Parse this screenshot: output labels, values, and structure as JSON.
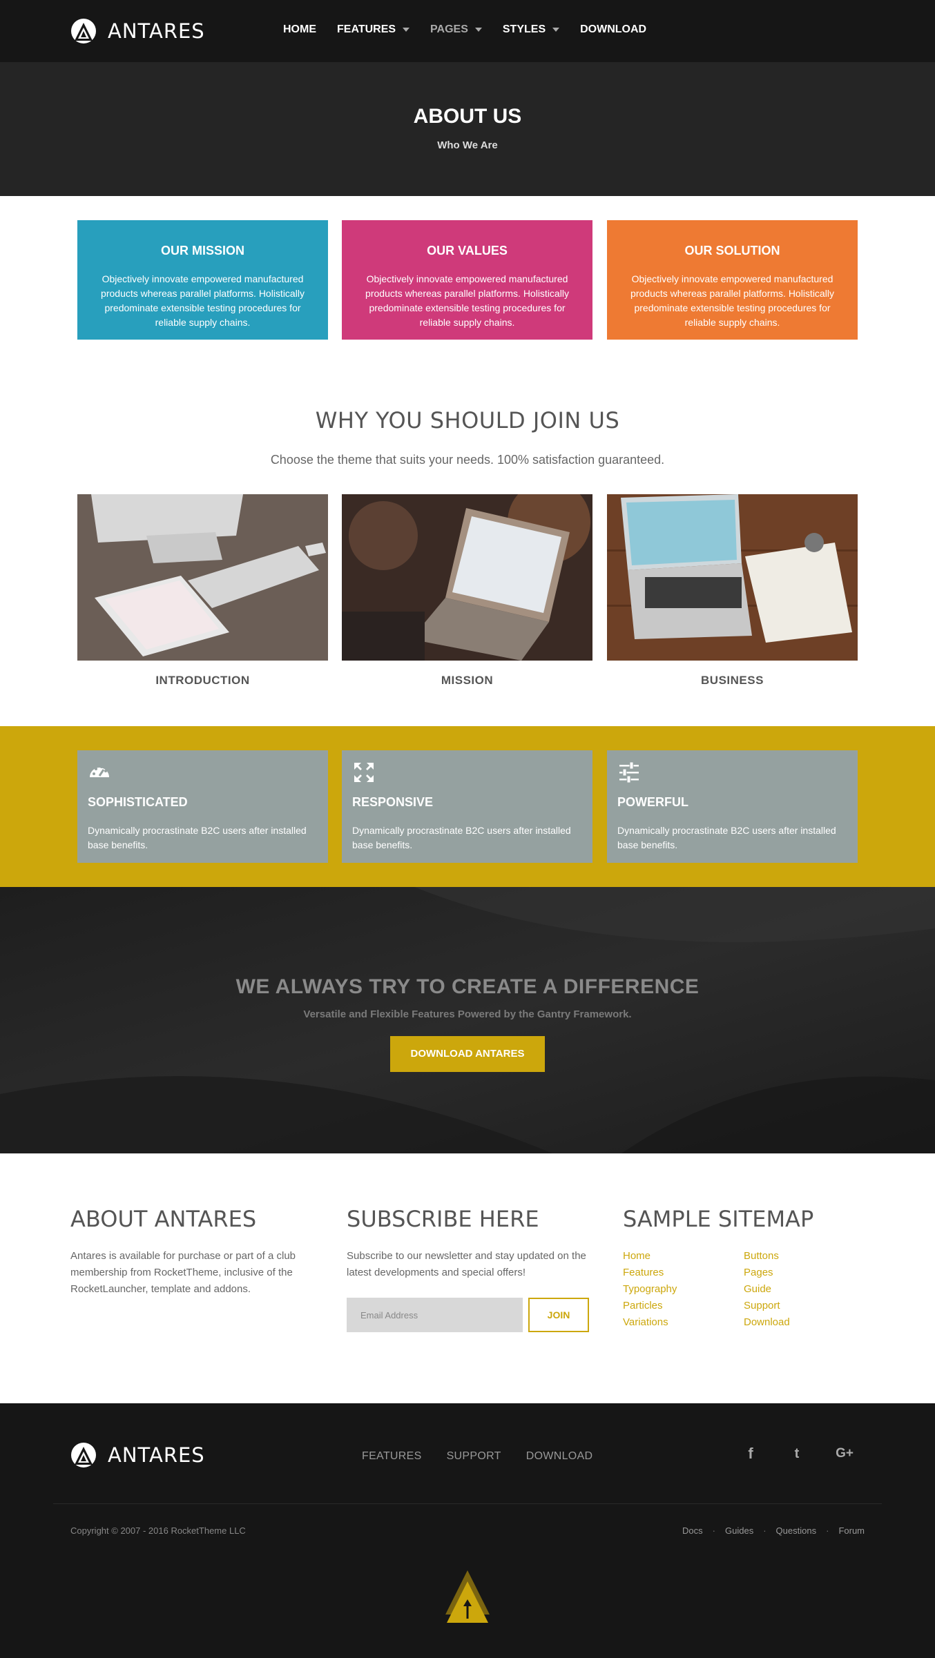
{
  "header": {
    "logo_text": "ANTARES",
    "nav": [
      {
        "label": "HOME"
      },
      {
        "label": "FEATURES"
      },
      {
        "label": "PAGES"
      },
      {
        "label": "STYLES"
      },
      {
        "label": "DOWNLOAD"
      }
    ]
  },
  "hero": {
    "title": "ABOUT US",
    "subtitle": "Who We Are"
  },
  "cards": [
    {
      "title": "OUR MISSION",
      "text": "Objectively innovate empowered manufactured products whereas parallel platforms. Holistically predominate extensible testing procedures for reliable supply chains.",
      "color": "#289fbd"
    },
    {
      "title": "OUR VALUES",
      "text": "Objectively innovate empowered manufactured products whereas parallel platforms. Holistically predominate extensible testing procedures for reliable supply chains.",
      "color": "#cf3a7a"
    },
    {
      "title": "OUR SOLUTION",
      "text": "Objectively innovate empowered manufactured products whereas parallel platforms. Holistically predominate extensible testing procedures for reliable supply chains.",
      "color": "#ee7a33"
    }
  ],
  "why": {
    "title": "WHY YOU SHOULD JOIN US",
    "subtitle": "Choose the theme that suits your needs. 100% satisfaction guaranteed.",
    "items": [
      {
        "label": "INTRODUCTION"
      },
      {
        "label": "MISSION"
      },
      {
        "label": "BUSINESS"
      }
    ]
  },
  "features": [
    {
      "icon": "dashboard-icon",
      "title": "SOPHISTICATED",
      "text": "Dynamically procrastinate B2C users after installed base benefits."
    },
    {
      "icon": "expand-arrows-icon",
      "title": "RESPONSIVE",
      "text": "Dynamically procrastinate B2C users after installed base benefits."
    },
    {
      "icon": "sliders-icon",
      "title": "POWERFUL",
      "text": "Dynamically procrastinate B2C users after installed base benefits."
    }
  ],
  "cta": {
    "title": "WE ALWAYS TRY TO CREATE A DIFFERENCE",
    "subtitle": "Versatile and Flexible Features Powered by the Gantry Framework.",
    "button": "DOWNLOAD ANTARES"
  },
  "about": {
    "title": "ABOUT ANTARES",
    "text": "Antares is available for purchase or part of a club membership from RocketTheme, inclusive of the RocketLauncher, template and addons."
  },
  "subscribe": {
    "title": "SUBSCRIBE HERE",
    "text": "Subscribe to our newsletter and stay updated on the latest developments and special offers!",
    "placeholder": "Email Address",
    "button": "JOIN"
  },
  "sitemap": {
    "title": "SAMPLE SITEMAP",
    "col1": [
      "Home",
      "Features",
      "Typography",
      "Particles",
      "Variations"
    ],
    "col2": [
      "Buttons",
      "Pages",
      "Guide",
      "Support",
      "Download"
    ]
  },
  "footer": {
    "logo_text": "ANTARES",
    "nav": [
      "FEATURES",
      "SUPPORT",
      "DOWNLOAD"
    ],
    "social": [
      "facebook-icon",
      "twitter-icon",
      "google-plus-icon"
    ],
    "social_glyphs": [
      "f",
      "t",
      "G+"
    ],
    "copyright": "Copyright © 2007 - 2016 RocketTheme LLC",
    "links": [
      "Docs",
      "Guides",
      "Questions",
      "Forum"
    ]
  },
  "colors": {
    "accent": "#cca70c",
    "dark": "#161616",
    "feature_card": "#95a1a0"
  }
}
